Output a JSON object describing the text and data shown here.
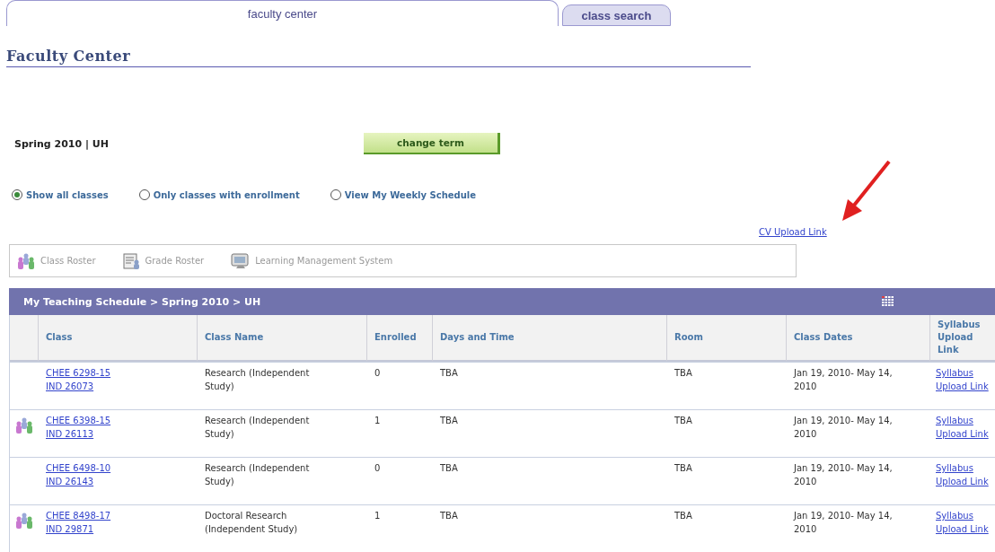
{
  "tabs": [
    {
      "label": "faculty center",
      "selected": true
    },
    {
      "label": "class search",
      "selected": false
    }
  ],
  "page_title": "Faculty Center",
  "term": {
    "label": "Spring 2010 | UH",
    "button": "change term"
  },
  "view_options": [
    {
      "label": "Show all classes",
      "selected": true
    },
    {
      "label": "Only classes with enrollment",
      "selected": false
    },
    {
      "label": "View My Weekly Schedule",
      "selected": false
    }
  ],
  "cv_link": "CV Upload Link",
  "toolbar": [
    {
      "kind": "roster",
      "label": "Class Roster"
    },
    {
      "kind": "grade",
      "label": "Grade Roster"
    },
    {
      "kind": "lms",
      "label": "Learning Management System"
    }
  ],
  "schedule": {
    "title": "My Teaching Schedule > Spring 2010 > UH",
    "columns": [
      "Class",
      "Class Name",
      "Enrolled",
      "Days and Time",
      "Room",
      "Class Dates",
      "Syllabus Upload Link"
    ],
    "rows": [
      {
        "roster_icon": false,
        "class": [
          "CHEE 6298-15",
          "IND 26073"
        ],
        "class_name": "Research (Independent Study)",
        "enrolled": "0",
        "days_time": "TBA",
        "room": "TBA",
        "dates": "Jan 19, 2010- May 14, 2010",
        "syllabus": "Syllabus Upload Link"
      },
      {
        "roster_icon": true,
        "class": [
          "CHEE 6398-15",
          "IND 26113"
        ],
        "class_name": "Research (Independent Study)",
        "enrolled": "1",
        "days_time": "TBA",
        "room": "TBA",
        "dates": "Jan 19, 2010- May 14, 2010",
        "syllabus": "Syllabus Upload Link"
      },
      {
        "roster_icon": false,
        "class": [
          "CHEE 6498-10",
          "IND 26143"
        ],
        "class_name": "Research (Independent Study)",
        "enrolled": "0",
        "days_time": "TBA",
        "room": "TBA",
        "dates": "Jan 19, 2010- May 14, 2010",
        "syllabus": "Syllabus Upload Link"
      },
      {
        "roster_icon": true,
        "class": [
          "CHEE 8498-17",
          "IND 29871"
        ],
        "class_name": "Doctoral Research (Independent Study)",
        "enrolled": "1",
        "days_time": "TBA",
        "room": "TBA",
        "dates": "Jan 19, 2010- May 14, 2010",
        "syllabus": "Syllabus Upload Link"
      }
    ]
  }
}
